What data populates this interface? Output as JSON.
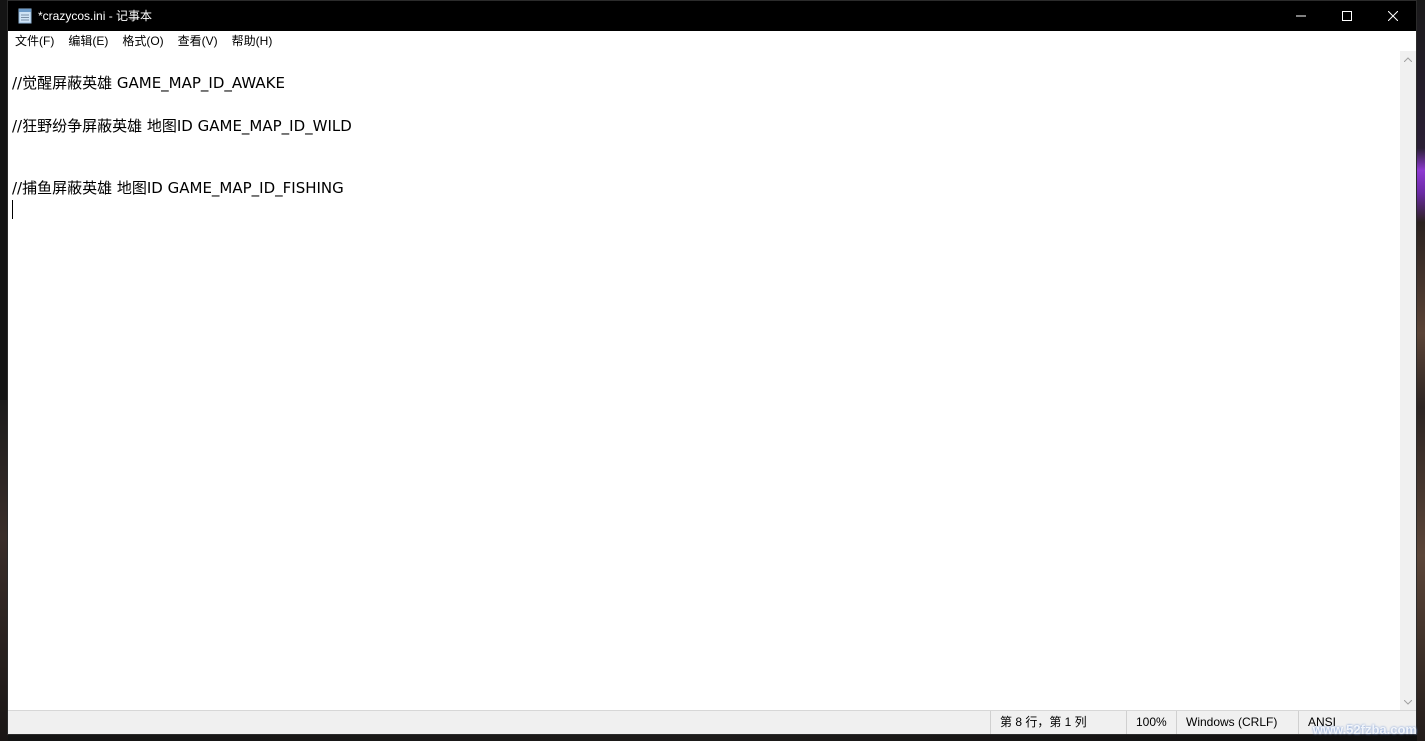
{
  "window": {
    "title": "*crazycos.ini - 记事本"
  },
  "titlebar_buttons": {
    "minimize_icon": "minimize-icon",
    "maximize_icon": "maximize-icon",
    "close_icon": "close-icon"
  },
  "menu": [
    {
      "label": "文件(F)"
    },
    {
      "label": "编辑(E)"
    },
    {
      "label": "格式(O)"
    },
    {
      "label": "查看(V)"
    },
    {
      "label": "帮助(H)"
    }
  ],
  "editor": {
    "lines": [
      "//觉醒屏蔽英雄 GAME_MAP_ID_AWAKE",
      "//狂野纷争屏蔽英雄 地图ID GAME_MAP_ID_WILD",
      "//捕鱼屏蔽英雄 地图ID GAME_MAP_ID_FISHING"
    ]
  },
  "statusbar": {
    "position": "第 8 行，第 1 列",
    "zoom": "100%",
    "line_ending": "Windows (CRLF)",
    "encoding": "ANSI"
  },
  "watermark": "www.52fzba.com",
  "colors": {
    "titlebar": "#000000",
    "statusbar": "#f0f0f0",
    "editor_bg": "#ffffff"
  }
}
